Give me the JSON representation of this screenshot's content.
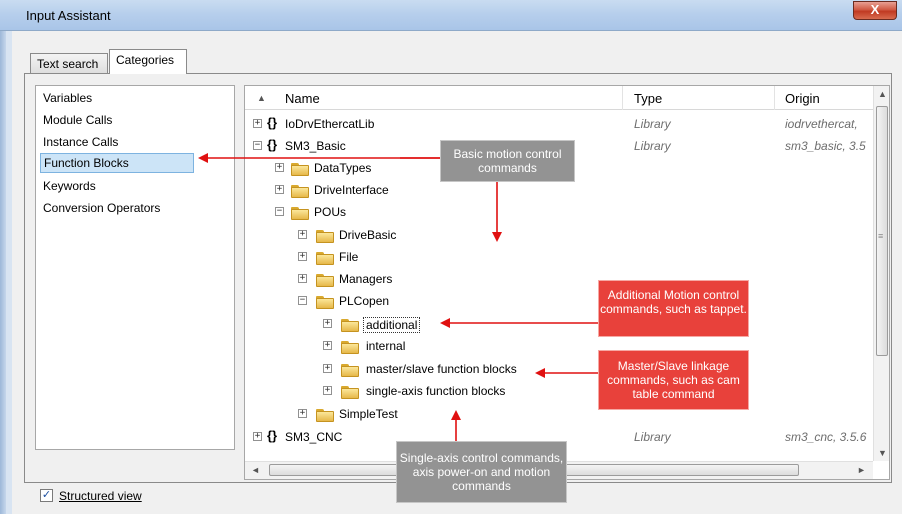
{
  "window": {
    "title": "Input Assistant",
    "close_label": "X"
  },
  "tabs": [
    {
      "label": "Text search"
    },
    {
      "label": "Categories"
    }
  ],
  "categories": [
    {
      "label": "Variables"
    },
    {
      "label": "Module Calls"
    },
    {
      "label": "Instance Calls"
    },
    {
      "label": "Function Blocks"
    },
    {
      "label": "Keywords"
    },
    {
      "label": "Conversion Operators"
    }
  ],
  "tree": {
    "columns": {
      "name": "Name",
      "type": "Type",
      "origin": "Origin"
    },
    "rows": [
      {
        "name": "IoDrvEthercatLib",
        "type": "Library",
        "origin": "iodrvethercat,"
      },
      {
        "name": "SM3_Basic",
        "type": "Library",
        "origin": "sm3_basic, 3.5"
      },
      {
        "name": "DataTypes"
      },
      {
        "name": "DriveInterface"
      },
      {
        "name": "POUs"
      },
      {
        "name": "DriveBasic"
      },
      {
        "name": "File"
      },
      {
        "name": "Managers"
      },
      {
        "name": "PLCopen"
      },
      {
        "name": "additional"
      },
      {
        "name": "internal"
      },
      {
        "name": "master/slave function blocks"
      },
      {
        "name": "single-axis function blocks"
      },
      {
        "name": "SimpleTest"
      },
      {
        "name": "SM3_CNC",
        "type": "Library",
        "origin": "sm3_cnc, 3.5.6"
      }
    ]
  },
  "structured_view": {
    "label": "Structured view",
    "checked": true
  },
  "callouts": {
    "basic": "Basic motion control commands",
    "additional": "Additional Motion control commands, such as tappet.",
    "master_slave": "Master/Slave linkage commands, such as cam table command",
    "single_axis": "Single-axis control commands, axis power-on and motion commands"
  },
  "colors": {
    "callout_gray": "#939393",
    "callout_red": "#e8413b",
    "arrow_red": "#e01010",
    "selection": "#cce4f7"
  }
}
